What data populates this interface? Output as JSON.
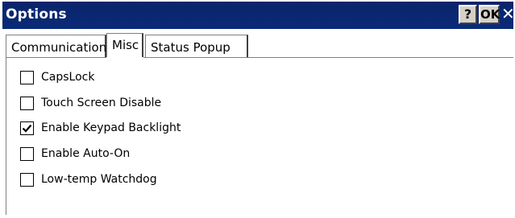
{
  "window": {
    "title": "Options",
    "help_label": "?",
    "ok_label": "OK",
    "close_label": "✕"
  },
  "tabs": [
    {
      "label": "Communication",
      "selected": false
    },
    {
      "label": "Misc",
      "selected": true
    },
    {
      "label": "Status Popup",
      "selected": false
    }
  ],
  "options": [
    {
      "label": "CapsLock",
      "checked": false
    },
    {
      "label": "Touch Screen Disable",
      "checked": false
    },
    {
      "label": "Enable Keypad Backlight",
      "checked": true
    },
    {
      "label": "Enable Auto-On",
      "checked": false
    },
    {
      "label": "Low-temp Watchdog",
      "checked": false
    }
  ],
  "colors": {
    "titlebar": "#0a246a",
    "button_face": "#d4d0c8"
  }
}
